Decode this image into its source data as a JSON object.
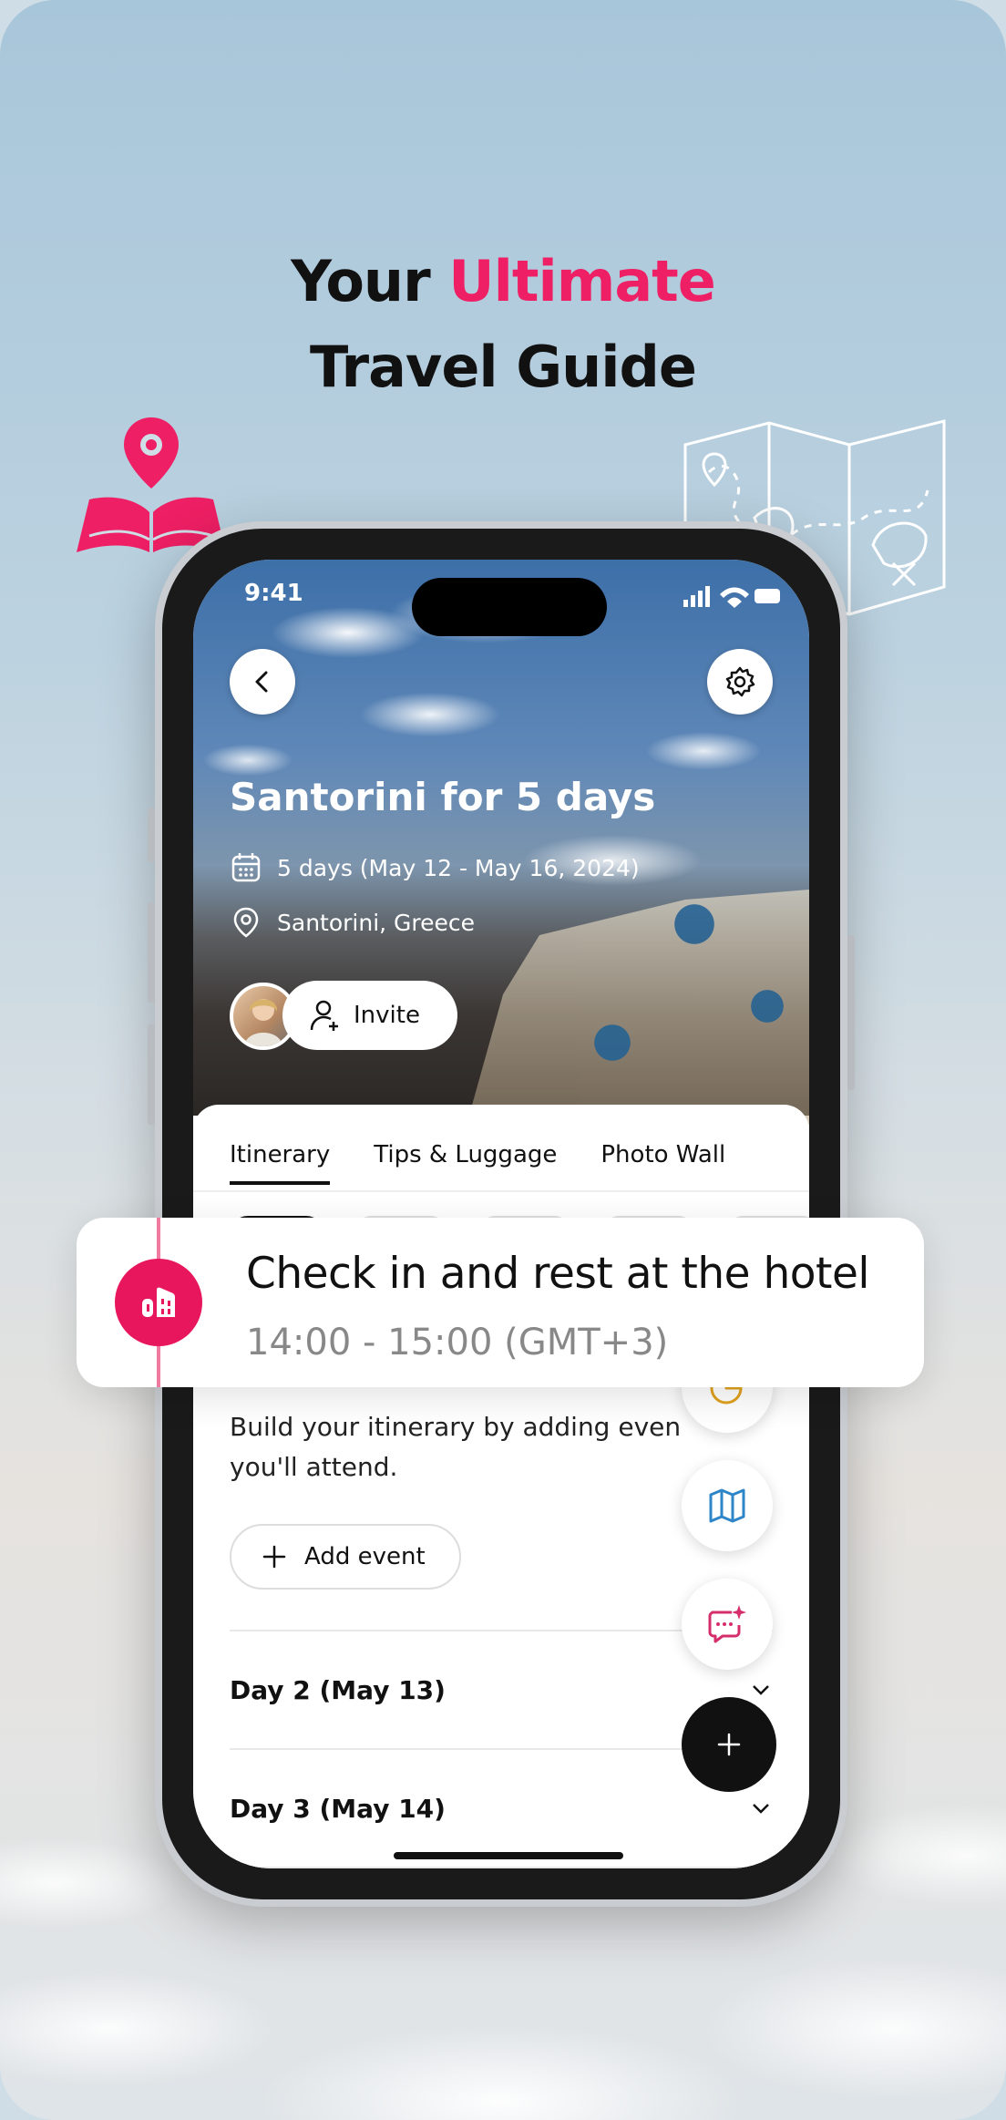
{
  "headline": {
    "part1": "Your ",
    "accent": "Ultimate",
    "line2": "Travel Guide"
  },
  "colors": {
    "accent": "#ee1f64",
    "text": "#111111",
    "muted": "#888888"
  },
  "status_bar": {
    "time": "9:41"
  },
  "trip": {
    "title": "Santorini for 5 days",
    "dates": "5 days (May 12 - May 16, 2024)",
    "location": "Santorini, Greece",
    "invite_label": "Invite"
  },
  "tabs": [
    {
      "label": "Itinerary",
      "active": true
    },
    {
      "label": "Tips & Luggage",
      "active": false
    },
    {
      "label": "Photo Wall",
      "active": false
    }
  ],
  "itinerary": {
    "build_text": "Build your itinerary by adding even you'll attend.",
    "add_event_label": "Add event",
    "days": [
      {
        "label": "Day 2 (May 13)"
      },
      {
        "label": "Day 3 (May 14)"
      }
    ]
  },
  "event_card": {
    "title": "Check in and rest at the hotel",
    "time": "14:00 - 15:00 (GMT+3)"
  },
  "icons": {
    "back": "chevron-left-icon",
    "settings": "gear-icon",
    "calendar": "calendar-icon",
    "location": "map-pin-icon",
    "invite": "add-user-icon",
    "add": "plus-icon",
    "hotel": "hotel-icon",
    "budget": "pie-chart-icon",
    "map": "map-icon",
    "ai_chat": "ai-chat-icon"
  }
}
